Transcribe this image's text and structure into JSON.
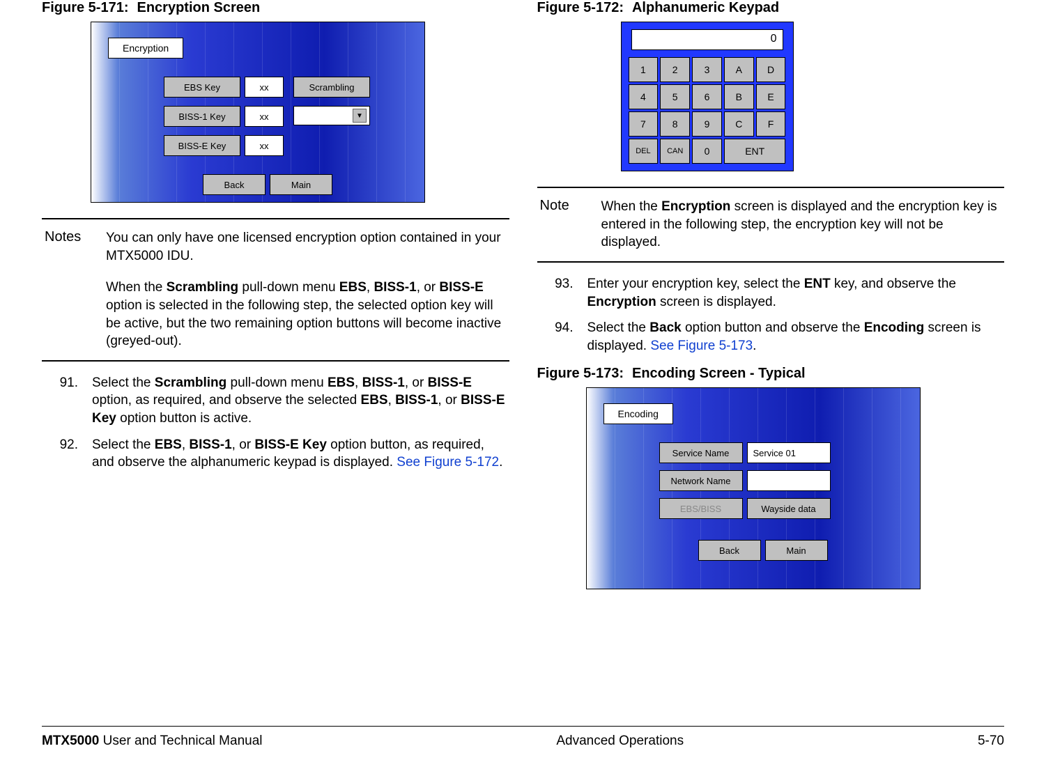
{
  "figures": {
    "f171": {
      "number": "Figure 5-171:",
      "title": "Encryption Screen"
    },
    "f172": {
      "number": "Figure 5-172:",
      "title": "Alphanumeric Keypad"
    },
    "f173": {
      "number": "Figure 5-173:",
      "title": "Encoding Screen - Typical"
    }
  },
  "encryption_screen": {
    "title": "Encryption",
    "ebs_label": "EBS Key",
    "biss1_label": "BISS-1 Key",
    "bisse_label": "BISS-E Key",
    "val": "xx",
    "scrambling_label": "Scrambling",
    "back": "Back",
    "main": "Main"
  },
  "keypad": {
    "display": "0",
    "keys_row1": [
      "1",
      "2",
      "3",
      "A",
      "D"
    ],
    "keys_row2": [
      "4",
      "5",
      "6",
      "B",
      "E"
    ],
    "keys_row3": [
      "7",
      "8",
      "9",
      "C",
      "F"
    ],
    "del": "DEL",
    "can": "CAN",
    "zero": "0",
    "ent": "ENT"
  },
  "encoding_screen": {
    "title": "Encoding",
    "service_name_label": "Service Name",
    "service_name_value": "Service 01",
    "network_name_label": "Network Name",
    "network_name_value": "",
    "ebsbiss_label": "EBS/BISS",
    "wayside_label": "Wayside data",
    "back": "Back",
    "main": "Main"
  },
  "notes_left": {
    "label": "Notes",
    "p1_a": "You can only have one licensed encryption option contained in your MTX5000 IDU.",
    "p2_a": "When the ",
    "p2_b": "Scrambling",
    "p2_c": " pull-down menu ",
    "p2_d": "EBS",
    "p2_e": ", ",
    "p2_f": "BISS-1",
    "p2_g": ", or ",
    "p2_h": "BISS-E",
    "p2_i": " option is selected in the following step, the selected option key will be active, but the two remaining option buttons will become inactive (greyed-out)."
  },
  "note_right": {
    "label": "Note",
    "a": "When the ",
    "b": "Encryption",
    "c": " screen is displayed and the encryption key is entered in the following step, the encryption key will not be displayed."
  },
  "steps": {
    "s91_num": "91.",
    "s91_a": "Select the ",
    "s91_b": "Scrambling",
    "s91_c": " pull-down menu ",
    "s91_d": "EBS",
    "s91_e": ", ",
    "s91_f": "BISS-1",
    "s91_g": ", or ",
    "s91_h": "BISS-E",
    "s91_i": " option, as required, and observe the selected ",
    "s91_j": "EBS",
    "s91_k": ", ",
    "s91_l": "BISS-1",
    "s91_m": ", or ",
    "s91_n": "BISS-E Key",
    "s91_o": " option button is active.",
    "s92_num": "92.",
    "s92_a": "Select the ",
    "s92_b": "EBS",
    "s92_c": ", ",
    "s92_d": "BISS-1",
    "s92_e": ", or ",
    "s92_f": "BISS-E Key",
    "s92_g": " option button, as required, and observe the alphanumeric keypad is displayed.  ",
    "s92_link": "See Figure 5-172",
    "s92_end": ".",
    "s93_num": "93.",
    "s93_a": "Enter your encryption key, select the ",
    "s93_b": "ENT",
    "s93_c": " key, and observe the ",
    "s93_d": "Encryption",
    "s93_e": " screen is displayed.",
    "s94_num": "94.",
    "s94_a": "Select the ",
    "s94_b": "Back",
    "s94_c": " option button and observe the ",
    "s94_d": "Encoding",
    "s94_e": " screen is displayed.  ",
    "s94_link": "See Figure 5-173",
    "s94_end": "."
  },
  "footer": {
    "left_bold": "MTX5000",
    "left_rest": " User and Technical Manual",
    "center": "Advanced Operations",
    "right": "5-70"
  }
}
